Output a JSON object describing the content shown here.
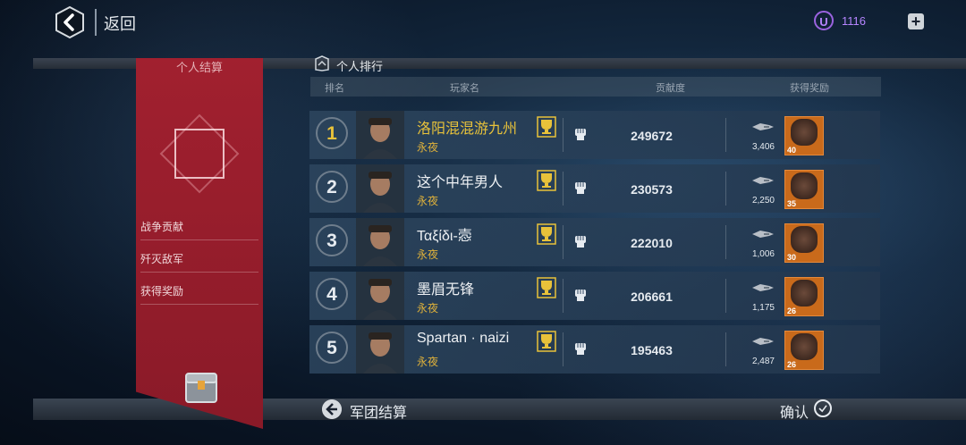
{
  "topbar": {
    "back_label": "返回",
    "currency_icon_letter": "U",
    "currency_value": "1116",
    "plus_label": "+"
  },
  "left_panel": {
    "title": "个人结算",
    "stats": [
      "战争贡献",
      "歼灭敌军",
      "获得奖励"
    ]
  },
  "ranking": {
    "title": "个人排行",
    "columns": {
      "rank": "排名",
      "player": "玩家名",
      "contribution": "贡献度",
      "reward": "获得奖励"
    },
    "rows": [
      {
        "rank": "1",
        "name": "洛阳混混游九州",
        "guild": "永夜",
        "score": "249672",
        "ship_count": "3,406",
        "reward_count": "40"
      },
      {
        "rank": "2",
        "name": "这个中年男人",
        "guild": "永夜",
        "score": "230573",
        "ship_count": "2,250",
        "reward_count": "35"
      },
      {
        "rank": "3",
        "name": "Ταξίδι-悫",
        "guild": "永夜",
        "score": "222010",
        "ship_count": "1,006",
        "reward_count": "30"
      },
      {
        "rank": "4",
        "name": "墨眉无锋",
        "guild": "永夜",
        "score": "206661",
        "ship_count": "1,175",
        "reward_count": "26"
      },
      {
        "rank": "5",
        "name": "Spartan · naizi",
        "guild": "永夜",
        "score": "195463",
        "ship_count": "2,487",
        "reward_count": "26"
      }
    ]
  },
  "bottom": {
    "legion_label": "军团结算",
    "confirm_label": "确认"
  },
  "colors": {
    "panel_red": "#a1202f",
    "gold": "#e8c23a",
    "currency_purple": "#b685ff",
    "reward_orange": "#c96a1b"
  }
}
